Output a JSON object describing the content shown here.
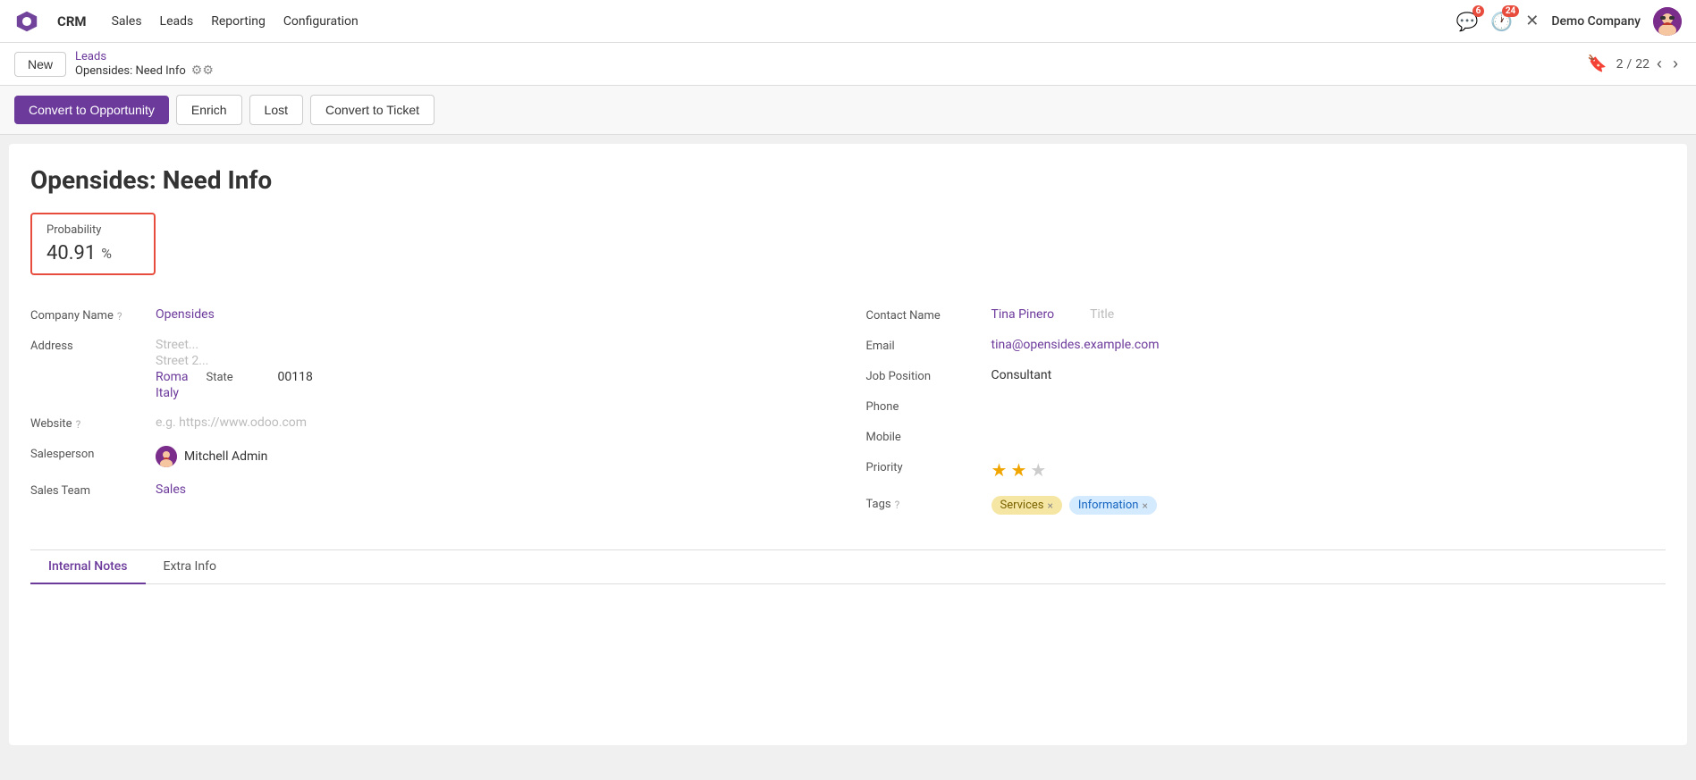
{
  "topnav": {
    "app": "CRM",
    "menu_items": [
      "Sales",
      "Leads",
      "Reporting",
      "Configuration"
    ],
    "notifications_count": "6",
    "clock_count": "24",
    "company": "Demo Company"
  },
  "breadcrumb": {
    "new_label": "New",
    "leads_link": "Leads",
    "current_page": "Opensides: Need Info",
    "page_current": "2",
    "page_total": "22"
  },
  "actions": {
    "convert_opportunity": "Convert to Opportunity",
    "enrich": "Enrich",
    "lost": "Lost",
    "convert_ticket": "Convert to Ticket"
  },
  "record": {
    "title": "Opensides: Need Info",
    "probability_label": "Probability",
    "probability_value": "40.91",
    "probability_pct": "%"
  },
  "left_fields": {
    "company_name_label": "Company Name",
    "company_name_value": "Opensides",
    "address_label": "Address",
    "street_placeholder": "Street...",
    "street2_placeholder": "Street 2...",
    "city_value": "Roma",
    "state_label": "State",
    "zip_value": "00118",
    "country_value": "Italy",
    "website_label": "Website",
    "website_placeholder": "e.g. https://www.odoo.com",
    "salesperson_label": "Salesperson",
    "salesperson_name": "Mitchell Admin",
    "sales_team_label": "Sales Team",
    "sales_team_value": "Sales"
  },
  "right_fields": {
    "contact_name_label": "Contact Name",
    "contact_name_value": "Tina Pinero",
    "title_label": "Title",
    "email_label": "Email",
    "email_value": "tina@opensides.example.com",
    "job_position_label": "Job Position",
    "job_position_value": "Consultant",
    "phone_label": "Phone",
    "mobile_label": "Mobile",
    "priority_label": "Priority",
    "priority_filled": 2,
    "priority_total": 3,
    "tags_label": "Tags",
    "tags": [
      {
        "label": "Services",
        "style": "services"
      },
      {
        "label": "Information",
        "style": "information"
      }
    ]
  },
  "tabs": [
    {
      "label": "Internal Notes",
      "active": true
    },
    {
      "label": "Extra Info",
      "active": false
    }
  ]
}
